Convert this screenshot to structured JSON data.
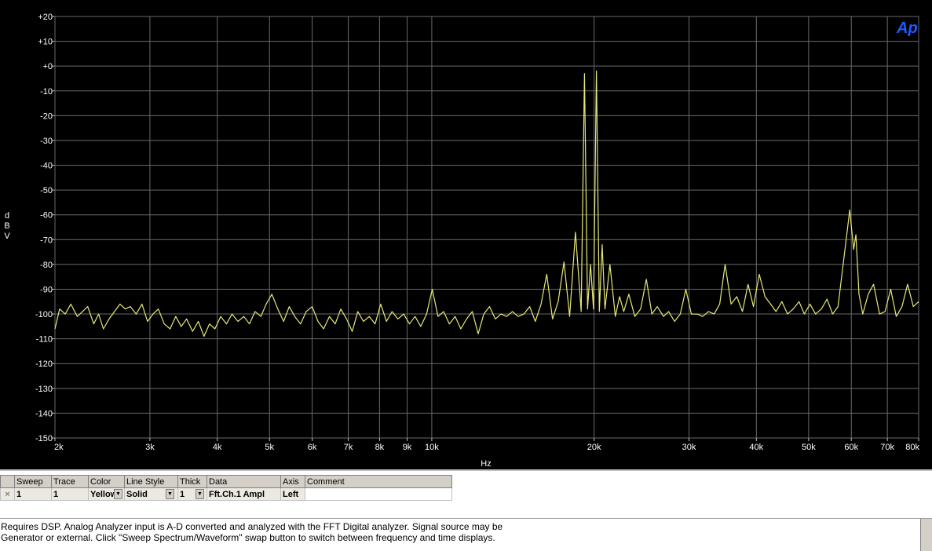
{
  "chart_data": {
    "type": "line",
    "xlabel": "Hz",
    "ylabel": "dBV",
    "xscale": "log",
    "xlim": [
      2000,
      80000
    ],
    "ylim": [
      -150,
      20
    ],
    "grid": true,
    "logo": "Ap",
    "x_ticks": [
      {
        "value": 2000,
        "label": "2k"
      },
      {
        "value": 3000,
        "label": "3k"
      },
      {
        "value": 4000,
        "label": "4k"
      },
      {
        "value": 5000,
        "label": "5k"
      },
      {
        "value": 6000,
        "label": "6k"
      },
      {
        "value": 7000,
        "label": "7k"
      },
      {
        "value": 8000,
        "label": "8k"
      },
      {
        "value": 9000,
        "label": "9k"
      },
      {
        "value": 10000,
        "label": "10k"
      },
      {
        "value": 20000,
        "label": "20k"
      },
      {
        "value": 30000,
        "label": "30k"
      },
      {
        "value": 40000,
        "label": "40k"
      },
      {
        "value": 50000,
        "label": "50k"
      },
      {
        "value": 60000,
        "label": "60k"
      },
      {
        "value": 70000,
        "label": "70k"
      },
      {
        "value": 80000,
        "label": "80k"
      }
    ],
    "y_ticks": [
      {
        "value": 20,
        "label": "+20"
      },
      {
        "value": 10,
        "label": "+10"
      },
      {
        "value": 0,
        "label": "+0"
      },
      {
        "value": -10,
        "label": "-10"
      },
      {
        "value": -20,
        "label": "-20"
      },
      {
        "value": -30,
        "label": "-30"
      },
      {
        "value": -40,
        "label": "-40"
      },
      {
        "value": -50,
        "label": "-50"
      },
      {
        "value": -60,
        "label": "-60"
      },
      {
        "value": -70,
        "label": "-70"
      },
      {
        "value": -80,
        "label": "-80"
      },
      {
        "value": -90,
        "label": "-90"
      },
      {
        "value": -100,
        "label": "-100"
      },
      {
        "value": -110,
        "label": "-110"
      },
      {
        "value": -120,
        "label": "-120"
      },
      {
        "value": -130,
        "label": "-130"
      },
      {
        "value": -140,
        "label": "-140"
      },
      {
        "value": -150,
        "label": "-150"
      }
    ],
    "series": [
      {
        "color": "#e8e878",
        "points": [
          [
            2000,
            -106
          ],
          [
            2040,
            -98
          ],
          [
            2090,
            -100
          ],
          [
            2140,
            -96
          ],
          [
            2200,
            -101
          ],
          [
            2250,
            -99
          ],
          [
            2300,
            -97
          ],
          [
            2360,
            -104
          ],
          [
            2410,
            -100
          ],
          [
            2460,
            -106
          ],
          [
            2520,
            -102
          ],
          [
            2580,
            -99
          ],
          [
            2640,
            -96
          ],
          [
            2700,
            -98
          ],
          [
            2760,
            -97
          ],
          [
            2830,
            -100
          ],
          [
            2900,
            -96
          ],
          [
            2970,
            -103
          ],
          [
            3040,
            -100
          ],
          [
            3110,
            -98
          ],
          [
            3190,
            -104
          ],
          [
            3270,
            -106
          ],
          [
            3350,
            -101
          ],
          [
            3430,
            -105
          ],
          [
            3510,
            -102
          ],
          [
            3600,
            -107
          ],
          [
            3690,
            -103
          ],
          [
            3780,
            -109
          ],
          [
            3870,
            -104
          ],
          [
            3960,
            -106
          ],
          [
            4060,
            -101
          ],
          [
            4160,
            -104
          ],
          [
            4260,
            -100
          ],
          [
            4370,
            -103
          ],
          [
            4480,
            -101
          ],
          [
            4590,
            -104
          ],
          [
            4700,
            -99
          ],
          [
            4820,
            -101
          ],
          [
            4930,
            -96
          ],
          [
            5050,
            -92
          ],
          [
            5180,
            -98
          ],
          [
            5310,
            -103
          ],
          [
            5440,
            -97
          ],
          [
            5570,
            -101
          ],
          [
            5710,
            -104
          ],
          [
            5850,
            -99
          ],
          [
            6000,
            -97
          ],
          [
            6150,
            -103
          ],
          [
            6300,
            -106
          ],
          [
            6460,
            -101
          ],
          [
            6620,
            -104
          ],
          [
            6780,
            -98
          ],
          [
            6950,
            -102
          ],
          [
            7120,
            -107
          ],
          [
            7290,
            -99
          ],
          [
            7470,
            -103
          ],
          [
            7660,
            -101
          ],
          [
            7850,
            -104
          ],
          [
            8040,
            -96
          ],
          [
            8240,
            -103
          ],
          [
            8440,
            -99
          ],
          [
            8650,
            -102
          ],
          [
            8870,
            -100
          ],
          [
            9090,
            -104
          ],
          [
            9310,
            -101
          ],
          [
            9540,
            -105
          ],
          [
            9780,
            -100
          ],
          [
            10020,
            -90
          ],
          [
            10270,
            -101
          ],
          [
            10520,
            -99
          ],
          [
            10780,
            -104
          ],
          [
            11050,
            -101
          ],
          [
            11320,
            -106
          ],
          [
            11600,
            -102
          ],
          [
            11890,
            -99
          ],
          [
            12190,
            -108
          ],
          [
            12490,
            -100
          ],
          [
            12800,
            -97
          ],
          [
            13120,
            -102
          ],
          [
            13440,
            -100
          ],
          [
            13770,
            -101
          ],
          [
            14110,
            -99
          ],
          [
            14460,
            -101
          ],
          [
            14820,
            -100
          ],
          [
            15190,
            -97
          ],
          [
            15560,
            -103
          ],
          [
            15950,
            -96
          ],
          [
            16340,
            -84
          ],
          [
            16750,
            -102
          ],
          [
            17160,
            -95
          ],
          [
            17590,
            -79
          ],
          [
            18020,
            -101
          ],
          [
            18470,
            -67
          ],
          [
            18930,
            -99
          ],
          [
            19200,
            -3
          ],
          [
            19450,
            -98
          ],
          [
            19700,
            -80
          ],
          [
            19950,
            -98
          ],
          [
            20200,
            -2
          ],
          [
            20450,
            -99
          ],
          [
            20700,
            -72
          ],
          [
            20950,
            -98
          ],
          [
            21400,
            -80
          ],
          [
            21900,
            -101
          ],
          [
            22300,
            -93
          ],
          [
            22700,
            -99
          ],
          [
            23200,
            -92
          ],
          [
            23800,
            -101
          ],
          [
            24400,
            -98
          ],
          [
            25000,
            -86
          ],
          [
            25600,
            -100
          ],
          [
            26200,
            -97
          ],
          [
            26900,
            -101
          ],
          [
            27500,
            -99
          ],
          [
            28200,
            -103
          ],
          [
            28900,
            -100
          ],
          [
            29600,
            -90
          ],
          [
            30300,
            -100
          ],
          [
            31100,
            -100
          ],
          [
            31800,
            -101
          ],
          [
            32600,
            -99
          ],
          [
            33400,
            -100
          ],
          [
            34200,
            -96
          ],
          [
            35000,
            -80
          ],
          [
            35900,
            -96
          ],
          [
            36800,
            -93
          ],
          [
            37700,
            -99
          ],
          [
            38600,
            -88
          ],
          [
            39500,
            -97
          ],
          [
            40500,
            -84
          ],
          [
            41500,
            -93
          ],
          [
            42500,
            -96
          ],
          [
            43500,
            -99
          ],
          [
            44600,
            -95
          ],
          [
            45700,
            -100
          ],
          [
            46800,
            -98
          ],
          [
            48000,
            -95
          ],
          [
            49100,
            -100
          ],
          [
            50300,
            -96
          ],
          [
            51500,
            -100
          ],
          [
            52800,
            -98
          ],
          [
            54100,
            -94
          ],
          [
            55400,
            -100
          ],
          [
            56700,
            -97
          ],
          [
            58100,
            -78
          ],
          [
            59000,
            -66
          ],
          [
            59600,
            -58
          ],
          [
            60600,
            -74
          ],
          [
            61200,
            -68
          ],
          [
            62000,
            -92
          ],
          [
            63000,
            -100
          ],
          [
            64500,
            -92
          ],
          [
            66000,
            -88
          ],
          [
            67700,
            -100
          ],
          [
            69300,
            -99
          ],
          [
            71000,
            -90
          ],
          [
            72700,
            -101
          ],
          [
            74500,
            -97
          ],
          [
            76300,
            -88
          ],
          [
            78200,
            -97
          ],
          [
            80000,
            -95
          ]
        ]
      }
    ]
  },
  "legend": {
    "headers": [
      "",
      "Sweep",
      "Trace",
      "Color",
      "Line Style",
      "Thick",
      "Data",
      "Axis",
      "Comment"
    ],
    "rows": [
      {
        "check": "×",
        "sweep": "1",
        "trace": "1",
        "color": "Yellow",
        "line_style": "Solid",
        "thick": "1",
        "data": "Fft.Ch.1 Ampl",
        "axis": "Left",
        "comment": ""
      }
    ]
  },
  "description": "Requires DSP.  Analog Analyzer input is A-D converted and analyzed with the FFT Digital analyzer.  Signal source may be\nGenerator or external.  Click \"Sweep Spectrum/Waveform\" swap button to switch between frequency and time displays."
}
